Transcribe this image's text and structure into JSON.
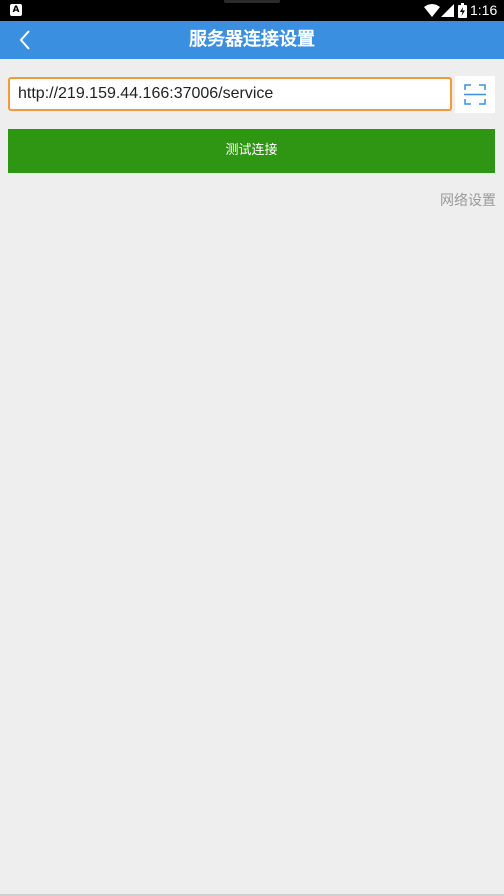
{
  "status_bar": {
    "app_badge": "A",
    "time": "1:16",
    "icons": [
      "wifi-icon",
      "signal-icon",
      "battery-icon"
    ]
  },
  "header": {
    "title": "服务器连接设置",
    "back_icon": "chevron-left-icon",
    "color": "#3a8fe0"
  },
  "form": {
    "url_value": "http://219.159.44.166:37006/service",
    "scan_icon": "scan-icon",
    "test_button_label": "测试连接",
    "network_settings_label": "网络设置"
  },
  "colors": {
    "accent": "#3a8fe0",
    "button": "#2e9612",
    "input_focus_border": "#f29a3b",
    "background": "#eeeeee"
  }
}
